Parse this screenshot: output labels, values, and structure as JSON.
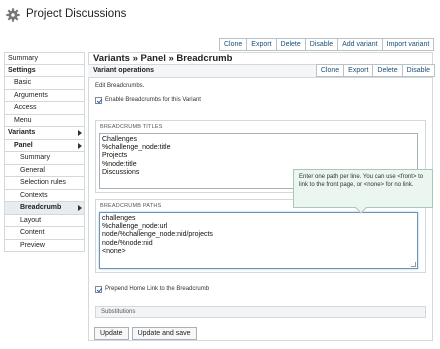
{
  "header": {
    "title": "Project Discussions",
    "icon": "gear-icon"
  },
  "top_actions": [
    "Clone",
    "Export",
    "Delete",
    "Disable",
    "Add variant",
    "Import variant"
  ],
  "sidebar": {
    "items": [
      {
        "label": "Summary"
      },
      {
        "label": "Settings"
      },
      {
        "label": "Basic"
      },
      {
        "label": "Arguments"
      },
      {
        "label": "Access"
      },
      {
        "label": "Menu"
      },
      {
        "label": "Variants"
      },
      {
        "label": "Panel"
      },
      {
        "label": "Summary"
      },
      {
        "label": "General"
      },
      {
        "label": "Selection rules"
      },
      {
        "label": "Contexts"
      },
      {
        "label": "Breadcrumb"
      },
      {
        "label": "Layout"
      },
      {
        "label": "Content"
      },
      {
        "label": "Preview"
      }
    ]
  },
  "main": {
    "title": "Variants » Panel » Breadcrumb",
    "subbar_title": "Variant operations",
    "subbar_actions": [
      "Clone",
      "Export",
      "Delete",
      "Disable"
    ],
    "edit_label": "Edit Breadcrumbs.",
    "enable_checkbox_label": "Enable Breadcrumbs for this Variant",
    "titles_legend": "BREADCRUMB TITLES",
    "titles_lines": [
      "Challenges",
      "%challenge_node:title",
      "Projects",
      "%node:title",
      "Discussions"
    ],
    "paths_legend": "BREADCRUMB PATHS",
    "paths_lines": [
      "challenges",
      "%challenge_node:url",
      "node/%challenge_node:nid/projects",
      "node/%node:nid",
      "<none>"
    ],
    "tooltip": "Enter one path per line. You can use <front> to link to the front page, or <none> for no link.",
    "prepend_checkbox_label": "Prepend Home Link to the Breadcrumb",
    "substitutions_label": "Substitutions",
    "update_button": "Update",
    "update_save_button": "Update and save"
  }
}
